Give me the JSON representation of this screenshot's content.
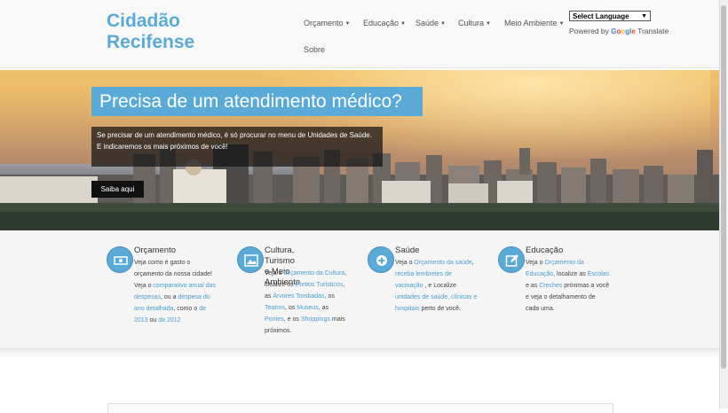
{
  "header": {
    "brand_line1": "Cidadão",
    "brand_line2": "Recifense",
    "nav": [
      {
        "label": "Orçamento",
        "dropdown": true
      },
      {
        "label": "Educação",
        "dropdown": true
      },
      {
        "label": "Saúde",
        "dropdown": true
      },
      {
        "label": "Cultura",
        "dropdown": true
      },
      {
        "label": "Meio Ambiente",
        "dropdown": true
      },
      {
        "label": "Sobre",
        "dropdown": false
      }
    ],
    "translate": {
      "select_value": "Select Language",
      "powered_by": "Powered by",
      "google": [
        "G",
        "o",
        "o",
        "g",
        "l",
        "e"
      ],
      "translate_word": "Translate"
    }
  },
  "hero": {
    "title": "Precisa de um atendimento médico?",
    "text": "Se precisar de um atendimento médico, é só procurar no menu de Unidades de Saúde. E indicaremos os mais próximos de você!",
    "button": "Saiba aqui"
  },
  "features": {
    "orcamento": {
      "title": "Orçamento",
      "icon": "money-icon",
      "t1": "Veja como é gasto o",
      "t2": "orçamento da nossa cidade!",
      "t3": "Veja o ",
      "l1a": "comparativo anual das",
      "l1b": "despesas",
      "t4": ", ou a ",
      "l2a": "despesa do",
      "l2b": "ano detalhada",
      "t5": ", como o ",
      "l3a": "de",
      "l3b": "2013",
      "t6": " ou ",
      "l4": "da 2012"
    },
    "cultura": {
      "title_line1": "Cultura, Turismo e Meio",
      "title_line2": "Ambiente",
      "icon": "picture-icon",
      "t1": "Veja o ",
      "l1": "Orçamento da Cultura",
      "t2": ",",
      "t3": "localize os ",
      "l2": "Pontos Turísticos",
      "t4": ",",
      "t5": "as ",
      "l3": "Árvores Tombadas",
      "t6": ", os",
      "l4": "Teatros",
      "t7": ", os ",
      "l5": "Museus",
      "t8": ", as",
      "l6": "Pontes",
      "t9": ", e os ",
      "l7": "Shoppings",
      "t10": " mais",
      "t11": "próximos."
    },
    "saude": {
      "title": "Saúde",
      "icon": "plus-circle-icon",
      "t1": "Veja o ",
      "l1": "Orçamento da saúde",
      "t2": ",",
      "l2a": "receba lembretes de",
      "l2b": "vacinação",
      "t3": " , e Localize",
      "l3a": "unidades de saúde, clínicas e",
      "l3b": "hospitais",
      "t4": " perto de você."
    },
    "educacao": {
      "title": "Educação",
      "icon": "edit-icon",
      "t1": "Veja o ",
      "l1a": "Orçamento da",
      "l1b": "Educação",
      "t2": ", localize as ",
      "l2": "Escolas",
      "t3": "e as ",
      "l3": "Creches",
      "t4": " próximas a você",
      "t5": "e veja o detalhamento de",
      "t6": "cada uma."
    }
  },
  "colors": {
    "accent": "#5aaad8",
    "link": "#4a9ed3"
  }
}
